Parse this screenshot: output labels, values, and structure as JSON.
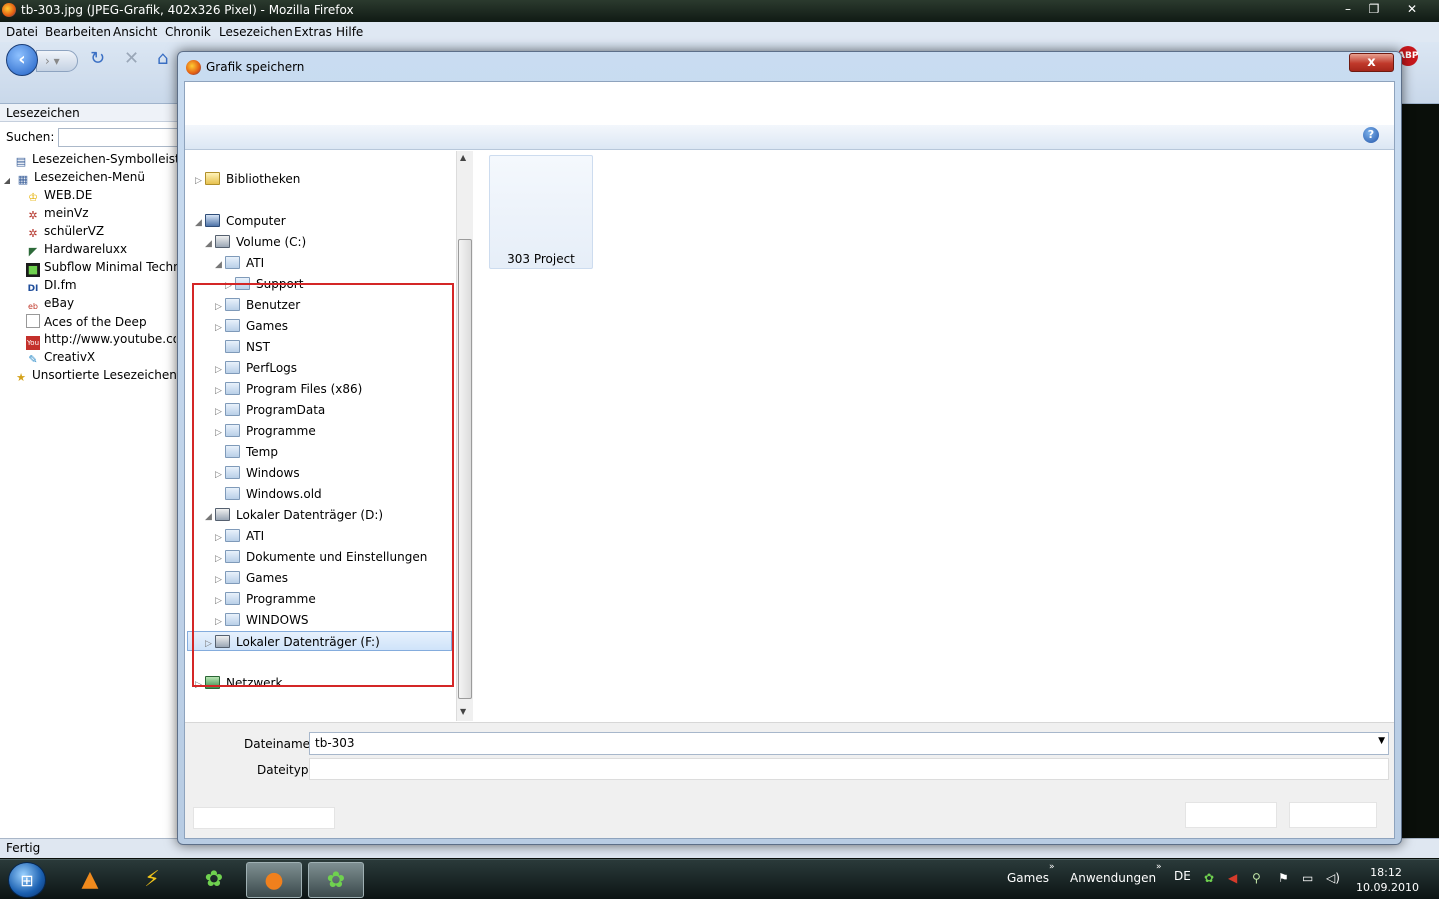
{
  "window": {
    "title": "tb-303.jpg (JPEG-Grafik, 402x326 Pixel) - Mozilla Firefox",
    "controls": [
      "–",
      "❐",
      "✕"
    ]
  },
  "menubar": [
    "Datei",
    "Bearbeiten",
    "Ansicht",
    "Chronik",
    "Lesezeichen",
    "Extras",
    "Hilfe"
  ],
  "navbar": {
    "abp_label": "ABP"
  },
  "sidebar": {
    "title": "Lesezeichen",
    "search_label": "Suchen:",
    "items": [
      {
        "label": "Lesezeichen-Symbolleiste",
        "icon": "toolbar-folder-icon"
      },
      {
        "label": "Lesezeichen-Menü",
        "icon": "menu-folder-icon"
      },
      {
        "label": "WEB.DE",
        "icon": "webde-icon"
      },
      {
        "label": "meinVz",
        "icon": "gear-icon"
      },
      {
        "label": "schülerVZ",
        "icon": "gear-icon"
      },
      {
        "label": "Hardwareluxx",
        "icon": "hardwareluxx-icon"
      },
      {
        "label": "Subflow Minimal Techno",
        "icon": "subflow-icon"
      },
      {
        "label": "DI.fm",
        "icon": "difm-icon"
      },
      {
        "label": "eBay",
        "icon": "ebay-icon"
      },
      {
        "label": "Aces of the Deep",
        "icon": "page-icon"
      },
      {
        "label": "http://www.youtube.com",
        "icon": "youtube-icon"
      },
      {
        "label": "CreativX",
        "icon": "feather-icon"
      },
      {
        "label": "Unsortierte Lesezeichen",
        "icon": "unsorted-folder-icon"
      }
    ]
  },
  "status": "Fertig",
  "dialog": {
    "title": "Grafik speichern",
    "close_label": "x",
    "help_label": "?",
    "tree": [
      {
        "label": "Bibliotheken",
        "type": "lib"
      },
      {
        "label": "Computer",
        "type": "pc"
      },
      {
        "label": "Volume (C:)",
        "type": "drv"
      },
      {
        "label": "ATI",
        "type": "fld"
      },
      {
        "label": "Support",
        "type": "fld"
      },
      {
        "label": "Benutzer",
        "type": "fld"
      },
      {
        "label": "Games",
        "type": "fld"
      },
      {
        "label": "NST",
        "type": "fld"
      },
      {
        "label": "PerfLogs",
        "type": "fld"
      },
      {
        "label": "Program Files (x86)",
        "type": "fld"
      },
      {
        "label": "ProgramData",
        "type": "fld"
      },
      {
        "label": "Programme",
        "type": "fld"
      },
      {
        "label": "Temp",
        "type": "fld"
      },
      {
        "label": "Windows",
        "type": "fld"
      },
      {
        "label": "Windows.old",
        "type": "fld"
      },
      {
        "label": "Lokaler Datenträger (D:)",
        "type": "drv"
      },
      {
        "label": "ATI",
        "type": "fld"
      },
      {
        "label": "Dokumente und Einstellungen",
        "type": "fld"
      },
      {
        "label": "Games",
        "type": "fld"
      },
      {
        "label": "Programme",
        "type": "fld"
      },
      {
        "label": "WINDOWS",
        "type": "fld"
      },
      {
        "label": "Lokaler Datenträger (F:)",
        "type": "drv",
        "selected": true
      },
      {
        "label": "Netzwerk",
        "type": "net"
      }
    ],
    "content_item": "303 Project",
    "filename_label": "Dateiname:",
    "filename_value": "tb-303",
    "filetype_label": "Dateityp:",
    "filetype_value": ""
  },
  "taskbar": {
    "toolbars": [
      "Games",
      "Anwendungen"
    ],
    "lang": "DE",
    "time": "18:12",
    "date": "10.09.2010"
  },
  "colors": {
    "highlight_box": "#d42626",
    "selection": "#cfe3fa"
  }
}
